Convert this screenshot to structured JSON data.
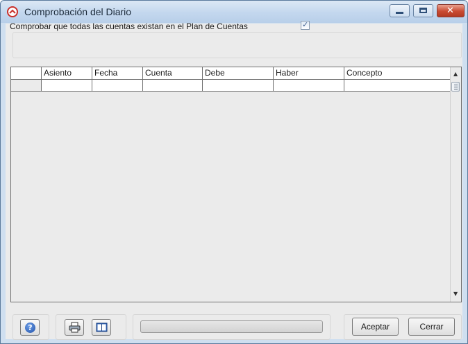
{
  "window": {
    "title": "Comprobación del Diario",
    "controls": {
      "minimize": "minimize-icon",
      "maximize": "maximize-icon",
      "close": "close-icon"
    }
  },
  "options": {
    "check_accounts_label": "Comprobar que todas las cuentas existan en el Plan de Cuentas",
    "check_accounts_checked": true
  },
  "grid": {
    "columns": [
      "Asiento",
      "Fecha",
      "Cuenta",
      "Debe",
      "Haber",
      "Concepto"
    ],
    "rows": [
      [
        "",
        "",
        "",
        "",
        "",
        ""
      ]
    ]
  },
  "progress": {
    "value": 0
  },
  "buttons": {
    "accept": "Aceptar",
    "close": "Cerrar",
    "help_icon": "help-icon",
    "print_icon": "printer-icon",
    "book_icon": "book-icon"
  },
  "colors": {
    "title_bar": "#c3d7ee",
    "close_button": "#c94a32",
    "client_bg": "#ebebeb"
  }
}
